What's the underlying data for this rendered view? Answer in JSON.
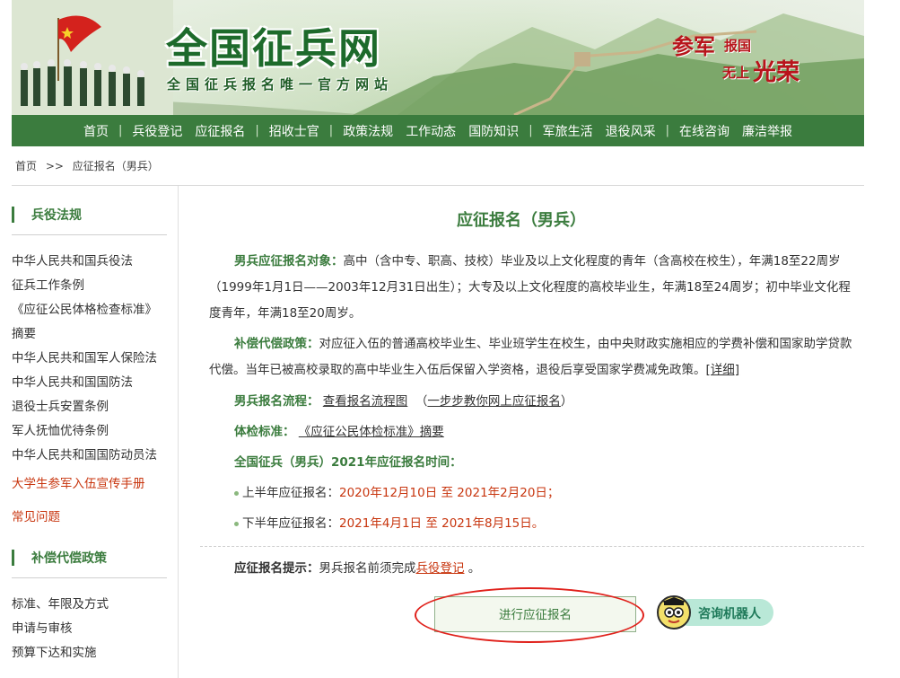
{
  "banner": {
    "logo_text": "全国征兵网",
    "slogan": "全国征兵报名唯一官方网站",
    "motto_1": "参军",
    "motto_2": "报国",
    "motto_3": "无上",
    "motto_4": "光荣"
  },
  "nav": {
    "groups": [
      [
        "首页"
      ],
      [
        "兵役登记",
        "应征报名"
      ],
      [
        "招收士官"
      ],
      [
        "政策法规",
        "工作动态",
        "国防知识"
      ],
      [
        "军旅生活",
        "退役风采"
      ],
      [
        "在线咨询",
        "廉洁举报"
      ]
    ],
    "separator": "|"
  },
  "breadcrumb": {
    "home": "首页",
    "arrow": ">>",
    "current": "应征报名（男兵）"
  },
  "sidebar": {
    "section1_title": "兵役法规",
    "section1_links": [
      "中华人民共和国兵役法",
      "征兵工作条例",
      "《应征公民体格检查标准》",
      "摘要",
      "中华人民共和国军人保险法",
      "中华人民共和国国防法",
      "退役士兵安置条例",
      "军人抚恤优待条例",
      "中华人民共和国国防动员法"
    ],
    "highlight_links": [
      "大学生参军入伍宣传手册",
      "常见问题"
    ],
    "section2_title": "补偿代偿政策",
    "section2_links": [
      "标准、年限及方式",
      "申请与审核",
      "预算下达和实施"
    ]
  },
  "main": {
    "title": "应征报名（男兵）",
    "target_label": "男兵应征报名对象：",
    "target_text": "高中（含中专、职高、技校）毕业及以上文化程度的青年（含高校在校生），年满18至22周岁（1999年1月1日——2003年12月31日出生）；大专及以上文化程度的高校毕业生，年满18至24周岁；初中毕业文化程度青年，年满18至20周岁。",
    "comp_label": "补偿代偿政策：",
    "comp_text": "对应征入伍的普通高校毕业生、毕业班学生在校生，由中央财政实施相应的学费补偿和国家助学贷款代偿。当年已被高校录取的高中毕业生入伍后保留入学资格，退役后享受国家学费减免政策。",
    "comp_link": "[详细]",
    "process_label": "男兵报名流程：",
    "process_link": "查看报名流程图",
    "process_link2": "一步步教你网上应征报名",
    "paren_open": "（",
    "paren_close": "）",
    "exam_label": "体检标准：",
    "exam_link": "《应征公民体检标准》摘要",
    "time_label": "全国征兵（男兵）2021年应征报名时间：",
    "first_half_label": "上半年应征报名：",
    "first_half_value": "2020年12月10日 至 2021年2月20日；",
    "second_half_label": "下半年应征报名：",
    "second_half_value": "2021年4月1日 至 2021年8月15日。",
    "tip_label": "应征报名提示：",
    "tip_text": "男兵报名前须完成",
    "tip_link": "兵役登记",
    "tip_end": "。",
    "apply_button": "进行应征报名",
    "robot_label": "咨询机器人"
  },
  "colors": {
    "nav_green": "#3b7c3e",
    "accent_red": "#c8360f",
    "circle_red": "#e0211b"
  }
}
